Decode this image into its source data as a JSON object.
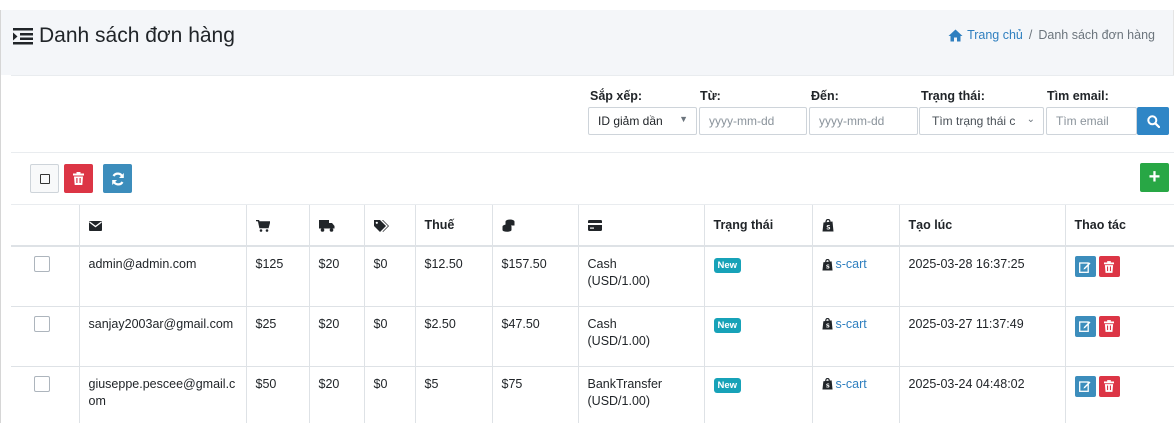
{
  "header": {
    "title": "Danh sách đơn hàng",
    "title_icon": "indent-list-icon",
    "breadcrumb": {
      "home": "Trang chủ",
      "separator": "/",
      "current": "Danh sách đơn hàng"
    }
  },
  "filters": {
    "sort": {
      "label": "Sắp xếp:",
      "value": "ID giảm dần"
    },
    "from": {
      "label": "Từ:",
      "placeholder": "yyyy-mm-dd"
    },
    "to": {
      "label": "Đến:",
      "placeholder": "yyyy-mm-dd"
    },
    "status": {
      "label": "Trạng thái:",
      "value": "Tìm trạng thái c"
    },
    "email": {
      "label": "Tìm email:",
      "placeholder": "Tìm email"
    }
  },
  "table": {
    "headers": {
      "email_icon": "envelope-icon",
      "subtotal_icon": "cart-icon",
      "shipping_icon": "truck-icon",
      "discount_icon": "tags-icon",
      "tax": "Thuế",
      "total_icon": "coins-icon",
      "payment_icon": "credit-card-icon",
      "status": "Trạng thái",
      "store_icon": "shopify-icon",
      "created": "Tạo lúc",
      "actions": "Thao tác"
    },
    "rows": [
      {
        "email": "admin@admin.com",
        "subtotal": "$125",
        "shipping": "$20",
        "discount": "$0",
        "tax": "$12.50",
        "total": "$157.50",
        "payment": "Cash",
        "currency": "(USD/1.00)",
        "status": "New",
        "store": "s-cart",
        "created": "2025-03-28 16:37:25"
      },
      {
        "email": "sanjay2003ar@gmail.com",
        "subtotal": "$25",
        "shipping": "$20",
        "discount": "$0",
        "tax": "$2.50",
        "total": "$47.50",
        "payment": "Cash",
        "currency": "(USD/1.00)",
        "status": "New",
        "store": "s-cart",
        "created": "2025-03-27 11:37:49"
      },
      {
        "email": "giuseppe.pescee@gmail.c\nom",
        "subtotal": "$50",
        "shipping": "$20",
        "discount": "$0",
        "tax": "$5",
        "total": "$75",
        "payment": "BankTransfer",
        "currency": "(USD/1.00)",
        "status": "New",
        "store": "s-cart",
        "created": "2025-03-24 04:48:02"
      }
    ]
  },
  "colors": {
    "primary": "#3c8dbc",
    "danger": "#dc3545",
    "success": "#28a745",
    "info": "#17a2b8",
    "link": "#2f7fbf"
  }
}
